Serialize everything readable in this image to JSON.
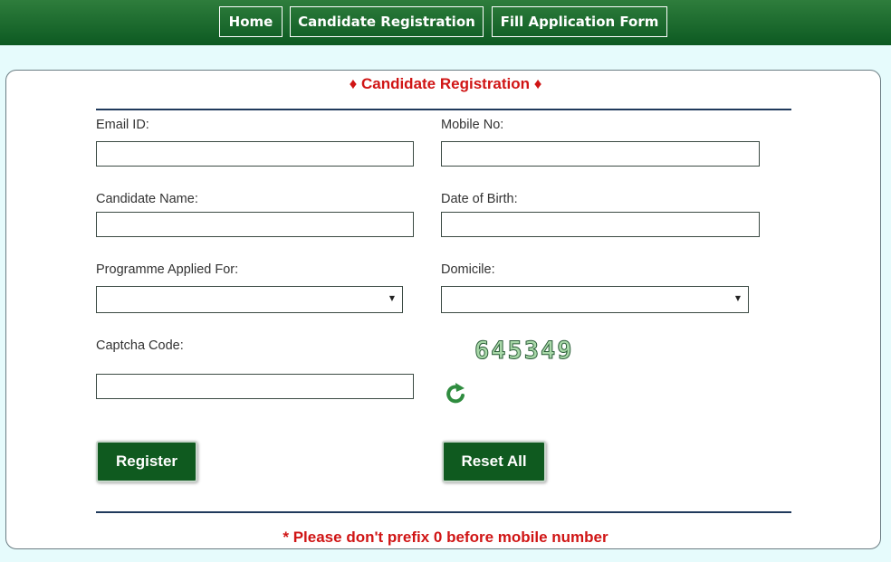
{
  "nav": {
    "home": "Home",
    "candidate_registration": "Candidate Registration",
    "fill_application_form": "Fill Application Form"
  },
  "form": {
    "title": "♦ Candidate Registration ♦",
    "email_label": "Email ID:",
    "email_value": "",
    "mobile_label": "Mobile No:",
    "mobile_value": "",
    "name_label": "Candidate Name:",
    "name_value": "",
    "dob_label": "Date of Birth:",
    "dob_value": "",
    "programme_label": "Programme Applied For:",
    "programme_selected": "",
    "domicile_label": "Domicile:",
    "domicile_selected": "",
    "captcha_label": "Captcha Code:",
    "captcha_value": "",
    "captcha_code": "645349",
    "register_label": "Register",
    "reset_label": "Reset All",
    "footnote": "* Please don't prefix 0 before mobile number"
  },
  "icons": {
    "captcha_refresh": "refresh-icon",
    "select_arrow": "dropdown-arrow-icon"
  },
  "colors": {
    "theme_green": "#0f5a1f",
    "accent_red": "#d01515",
    "page_bg": "#e6fbfc"
  }
}
